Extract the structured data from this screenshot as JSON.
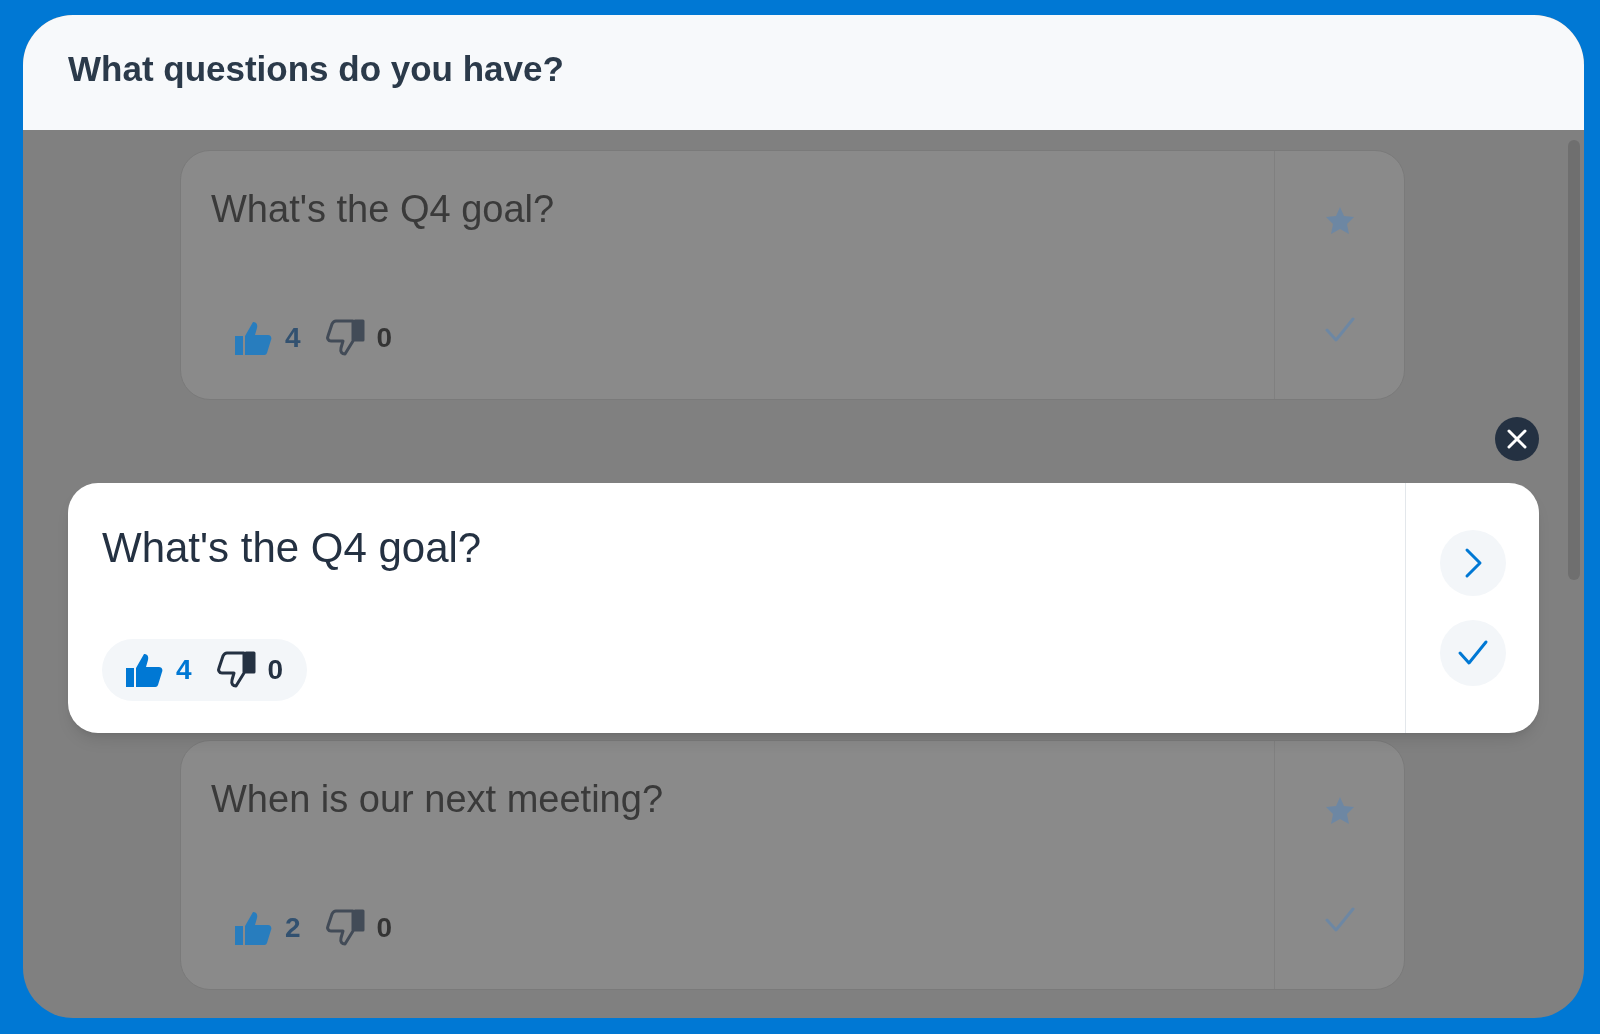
{
  "header": {
    "title": "What questions do you have?"
  },
  "background_questions": [
    {
      "text": "What's the Q4 goal?",
      "likes": "4",
      "dislikes": "0"
    },
    {
      "text": "When is our next meeting?",
      "likes": "2",
      "dislikes": "0"
    }
  ],
  "focused_question": {
    "text": "What's the Q4 goal?",
    "likes": "4",
    "dislikes": "0"
  }
}
